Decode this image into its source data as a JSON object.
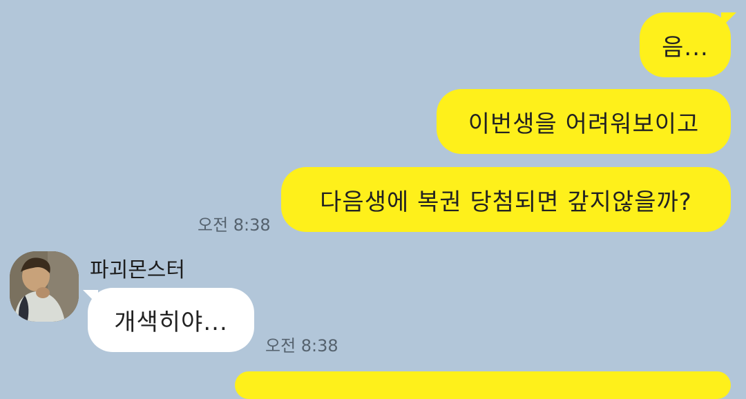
{
  "chat": {
    "messages_mine": [
      {
        "text": "음..."
      },
      {
        "text": "이번생을 어려워보이고"
      },
      {
        "text": "다음생에 복권 당첨되면 갚지않을까?"
      }
    ],
    "mine_time": "오전 8:38",
    "other": {
      "sender_name": "파괴몬스터",
      "message": "개색히야...",
      "time": "오전 8:38"
    }
  },
  "colors": {
    "background": "#b2c6d9",
    "my_bubble": "#fef01b",
    "other_bubble": "#ffffff"
  }
}
